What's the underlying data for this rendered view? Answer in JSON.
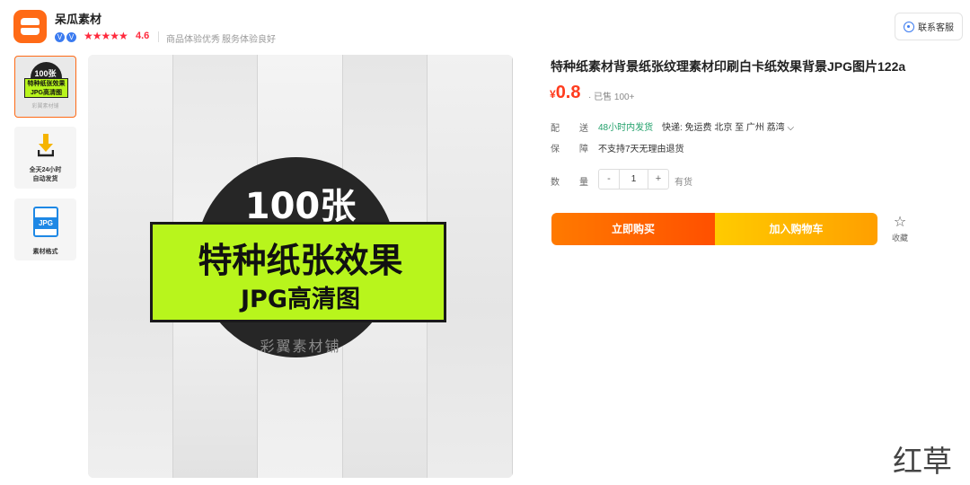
{
  "shop": {
    "name": "呆瓜素材",
    "badges": [
      "V",
      "V"
    ],
    "stars": "★★★★★",
    "rating": "4.6",
    "tags": [
      "商品体验优秀",
      "服务体验良好"
    ]
  },
  "header": {
    "service_label": "联系客服"
  },
  "thumbnails": [
    {
      "top": "100张",
      "l1": "特种纸张效果",
      "l2": "JPG高清图",
      "brand": "彩翼素材铺"
    },
    {
      "caption1": "全天24小时",
      "caption2": "自动发货"
    },
    {
      "badge": "JPG",
      "caption": "素材格式"
    }
  ],
  "main_image": {
    "count": "100张",
    "line1": "特种纸张效果",
    "line2": "JPG高清图",
    "brand": "彩翼素材铺"
  },
  "product": {
    "title": "特种纸素材背景纸张纹理素材印刷白卡纸效果背景JPG图片122a",
    "currency": "¥",
    "price": "0.8",
    "sold": "· 已售 100+",
    "shipping": {
      "label1": "配",
      "label2": "送",
      "fast": "48小时内发货",
      "rest": "快递: 免运费  北京  至  广州 荔湾 ⌵"
    },
    "guarantee": {
      "label1": "保",
      "label2": "障",
      "text": "不支持7天无理由退货"
    },
    "quantity": {
      "label1": "数",
      "label2": "量",
      "minus": "-",
      "value": "1",
      "plus": "+",
      "stock": "有货"
    },
    "buy_label": "立即购买",
    "cart_label": "加入购物车",
    "fav_icon": "☆",
    "fav_label": "收藏"
  },
  "watermark": "红草",
  "colors": {
    "accent": "#ff5000",
    "price": "#ff3c1e",
    "green": "#b8f51c",
    "ship": "#21a06a"
  }
}
